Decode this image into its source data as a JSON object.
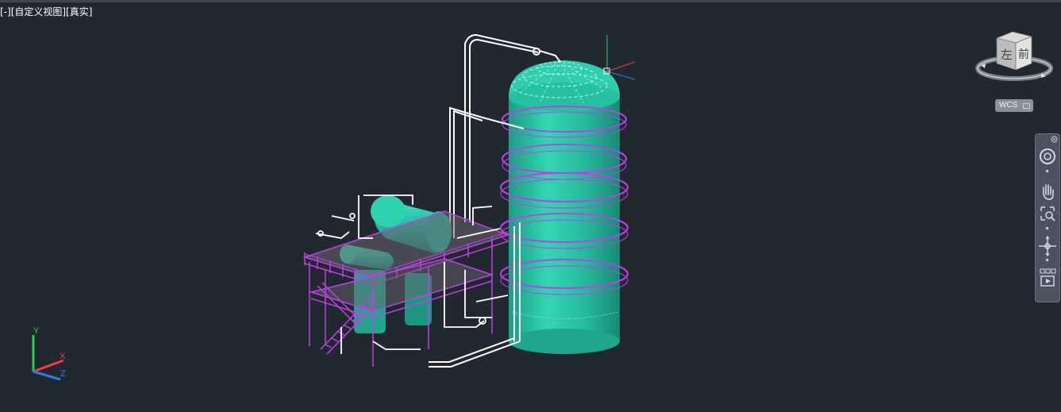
{
  "viewport": {
    "label": "[-][自定义视图][真实]",
    "background": "#212830"
  },
  "viewcube": {
    "left_face": "左",
    "front_face": "前"
  },
  "wcs": {
    "label": "WCS"
  },
  "navigation_bar": {
    "tools": [
      {
        "name": "steering-wheel",
        "icon": "steering-wheel-icon"
      },
      {
        "name": "pan",
        "icon": "hand-icon"
      },
      {
        "name": "zoom-extents",
        "icon": "zoom-icon"
      },
      {
        "name": "orbit",
        "icon": "orbit-icon"
      },
      {
        "name": "showmotion",
        "icon": "showmotion-icon"
      }
    ]
  },
  "ucs": {
    "x_label": "X",
    "y_label": "Y",
    "z_label": "Z",
    "x_color": "#e8423a",
    "y_color": "#2ec84a",
    "z_color": "#2a7de8"
  },
  "model": {
    "vessel_color": "#24b89c",
    "platform_color": "#b43cdc",
    "pipe_color": "#ffffff"
  }
}
